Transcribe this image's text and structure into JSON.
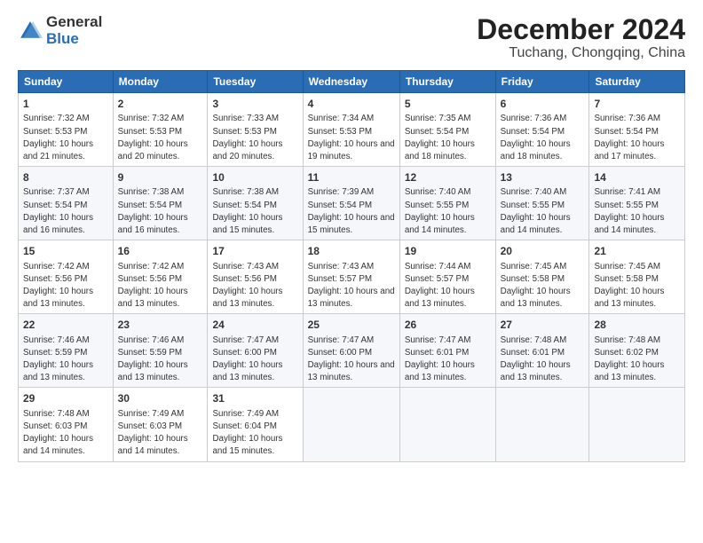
{
  "logo": {
    "general": "General",
    "blue": "Blue"
  },
  "title": "December 2024",
  "subtitle": "Tuchang, Chongqing, China",
  "headers": [
    "Sunday",
    "Monday",
    "Tuesday",
    "Wednesday",
    "Thursday",
    "Friday",
    "Saturday"
  ],
  "weeks": [
    [
      {
        "day": "1",
        "rise": "7:32 AM",
        "set": "5:53 PM",
        "hours": "10 hours and 21 minutes."
      },
      {
        "day": "2",
        "rise": "7:32 AM",
        "set": "5:53 PM",
        "hours": "10 hours and 20 minutes."
      },
      {
        "day": "3",
        "rise": "7:33 AM",
        "set": "5:53 PM",
        "hours": "10 hours and 20 minutes."
      },
      {
        "day": "4",
        "rise": "7:34 AM",
        "set": "5:53 PM",
        "hours": "10 hours and 19 minutes."
      },
      {
        "day": "5",
        "rise": "7:35 AM",
        "set": "5:54 PM",
        "hours": "10 hours and 18 minutes."
      },
      {
        "day": "6",
        "rise": "7:36 AM",
        "set": "5:54 PM",
        "hours": "10 hours and 18 minutes."
      },
      {
        "day": "7",
        "rise": "7:36 AM",
        "set": "5:54 PM",
        "hours": "10 hours and 17 minutes."
      }
    ],
    [
      {
        "day": "8",
        "rise": "7:37 AM",
        "set": "5:54 PM",
        "hours": "10 hours and 16 minutes."
      },
      {
        "day": "9",
        "rise": "7:38 AM",
        "set": "5:54 PM",
        "hours": "10 hours and 16 minutes."
      },
      {
        "day": "10",
        "rise": "7:38 AM",
        "set": "5:54 PM",
        "hours": "10 hours and 15 minutes."
      },
      {
        "day": "11",
        "rise": "7:39 AM",
        "set": "5:54 PM",
        "hours": "10 hours and 15 minutes."
      },
      {
        "day": "12",
        "rise": "7:40 AM",
        "set": "5:55 PM",
        "hours": "10 hours and 14 minutes."
      },
      {
        "day": "13",
        "rise": "7:40 AM",
        "set": "5:55 PM",
        "hours": "10 hours and 14 minutes."
      },
      {
        "day": "14",
        "rise": "7:41 AM",
        "set": "5:55 PM",
        "hours": "10 hours and 14 minutes."
      }
    ],
    [
      {
        "day": "15",
        "rise": "7:42 AM",
        "set": "5:56 PM",
        "hours": "10 hours and 13 minutes."
      },
      {
        "day": "16",
        "rise": "7:42 AM",
        "set": "5:56 PM",
        "hours": "10 hours and 13 minutes."
      },
      {
        "day": "17",
        "rise": "7:43 AM",
        "set": "5:56 PM",
        "hours": "10 hours and 13 minutes."
      },
      {
        "day": "18",
        "rise": "7:43 AM",
        "set": "5:57 PM",
        "hours": "10 hours and 13 minutes."
      },
      {
        "day": "19",
        "rise": "7:44 AM",
        "set": "5:57 PM",
        "hours": "10 hours and 13 minutes."
      },
      {
        "day": "20",
        "rise": "7:45 AM",
        "set": "5:58 PM",
        "hours": "10 hours and 13 minutes."
      },
      {
        "day": "21",
        "rise": "7:45 AM",
        "set": "5:58 PM",
        "hours": "10 hours and 13 minutes."
      }
    ],
    [
      {
        "day": "22",
        "rise": "7:46 AM",
        "set": "5:59 PM",
        "hours": "10 hours and 13 minutes."
      },
      {
        "day": "23",
        "rise": "7:46 AM",
        "set": "5:59 PM",
        "hours": "10 hours and 13 minutes."
      },
      {
        "day": "24",
        "rise": "7:47 AM",
        "set": "6:00 PM",
        "hours": "10 hours and 13 minutes."
      },
      {
        "day": "25",
        "rise": "7:47 AM",
        "set": "6:00 PM",
        "hours": "10 hours and 13 minutes."
      },
      {
        "day": "26",
        "rise": "7:47 AM",
        "set": "6:01 PM",
        "hours": "10 hours and 13 minutes."
      },
      {
        "day": "27",
        "rise": "7:48 AM",
        "set": "6:01 PM",
        "hours": "10 hours and 13 minutes."
      },
      {
        "day": "28",
        "rise": "7:48 AM",
        "set": "6:02 PM",
        "hours": "10 hours and 13 minutes."
      }
    ],
    [
      {
        "day": "29",
        "rise": "7:48 AM",
        "set": "6:03 PM",
        "hours": "10 hours and 14 minutes."
      },
      {
        "day": "30",
        "rise": "7:49 AM",
        "set": "6:03 PM",
        "hours": "10 hours and 14 minutes."
      },
      {
        "day": "31",
        "rise": "7:49 AM",
        "set": "6:04 PM",
        "hours": "10 hours and 15 minutes."
      },
      null,
      null,
      null,
      null
    ]
  ],
  "labels": {
    "sunrise": "Sunrise:",
    "sunset": "Sunset:",
    "daylight": "Daylight:"
  }
}
